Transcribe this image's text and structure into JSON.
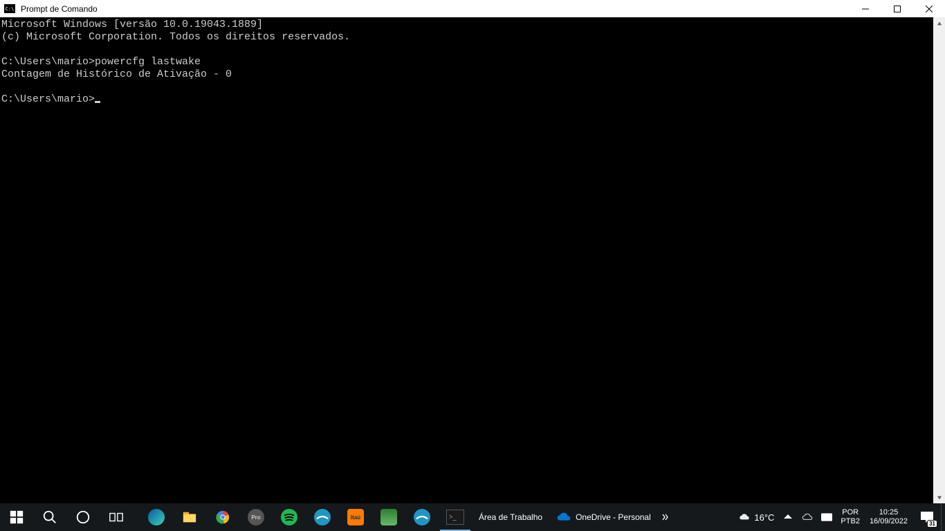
{
  "titlebar": {
    "icon_text": "C:\\",
    "title": "Prompt de Comando"
  },
  "terminal": {
    "line1": "Microsoft Windows [versão 10.0.19043.1889]",
    "line2": "(c) Microsoft Corporation. Todos os direitos reservados.",
    "blank1": "",
    "prompt1": "C:\\Users\\mario>",
    "command1": "powercfg lastwake",
    "output1": "Contagem de Histórico de Ativação - 0",
    "blank2": "",
    "prompt2": "C:\\Users\\mario>"
  },
  "taskbar": {
    "desktop_label": "Área de Trabalho",
    "onedrive_label": "OneDrive - Personal",
    "weather_temp": "16°C",
    "lang_top": "POR",
    "lang_bottom": "PTB2",
    "clock_time": "10:25",
    "clock_date": "16/09/2022",
    "notif_count": "31"
  }
}
